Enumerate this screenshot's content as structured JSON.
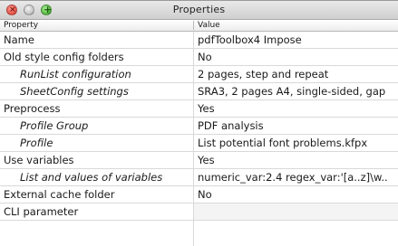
{
  "window": {
    "title": "Properties"
  },
  "table": {
    "headers": {
      "property": "Property",
      "value": "Value"
    },
    "rows": [
      {
        "name": "Name",
        "value": "pdfToolbox4 Impose"
      },
      {
        "name": "Old style config folders",
        "value": "No"
      },
      {
        "name": "RunList configuration",
        "value": "2 pages, step and repeat"
      },
      {
        "name": "SheetConfig settings",
        "value": "SRA3, 2 pages A4, single-sided, gap"
      },
      {
        "name": "Preprocess",
        "value": "Yes"
      },
      {
        "name": "Profile Group",
        "value": "PDF analysis"
      },
      {
        "name": "Profile",
        "value": "List potential font problems.kfpx"
      },
      {
        "name": "Use variables",
        "value": "Yes"
      },
      {
        "name": "List and values of variables",
        "value": "numeric_var:2.4 regex_var:'[a..z]\\w.."
      },
      {
        "name": "External cache folder",
        "value": "No"
      },
      {
        "name": "CLI parameter",
        "value": ""
      }
    ]
  },
  "colors": {
    "close": "#ec5b52",
    "minimize": "#c9c9c9",
    "zoom": "#5fbf4a"
  }
}
